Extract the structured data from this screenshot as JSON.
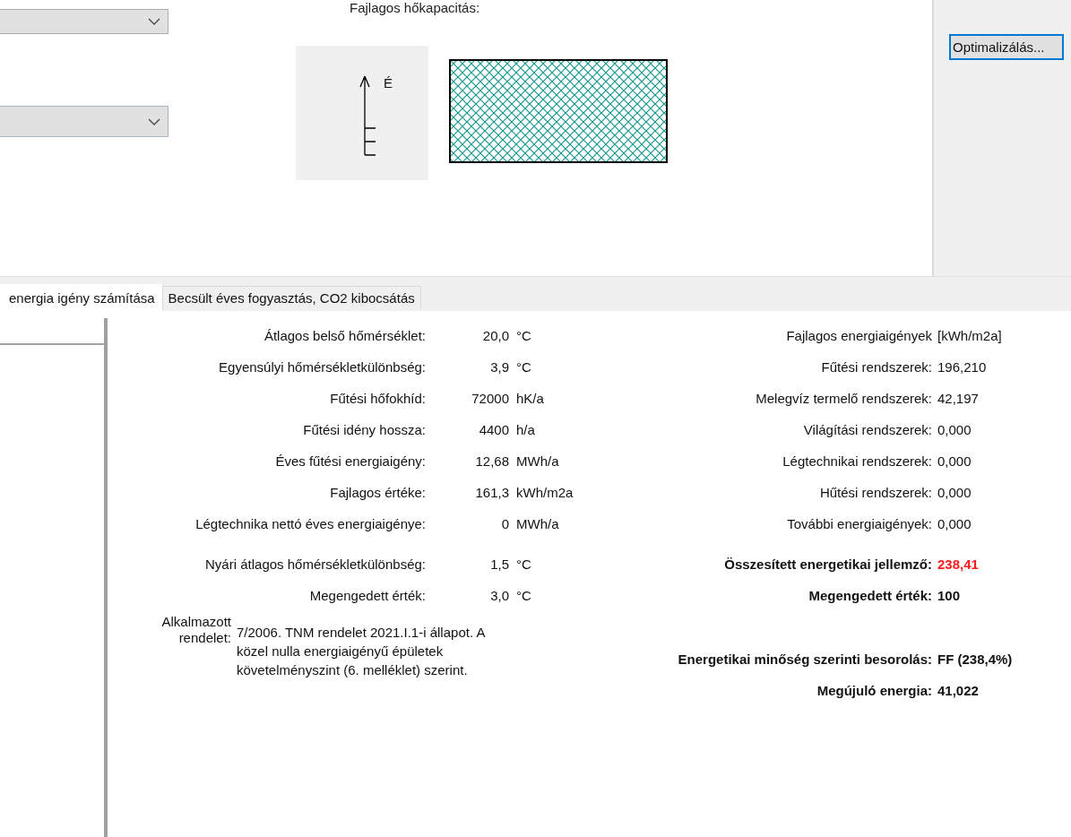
{
  "top": {
    "heading_label": "Fajlagos hőkapacitás:",
    "dropdowns": [
      {
        "focused": false
      },
      {
        "focused": true
      }
    ],
    "compass_label": "É",
    "button": "Optimalizálás..."
  },
  "tabs": [
    {
      "label": "energia igény számítása",
      "selected": true
    },
    {
      "label": "Becsült éves fogyasztás, CO2 kibocsátás",
      "selected": false
    }
  ],
  "left_rows": [
    {
      "label": "Átlagos belső hőmérséklet:",
      "value": "20,0",
      "unit": "°C"
    },
    {
      "label": "Egyensúlyi hőmérsékletkülönbség:",
      "value": "3,9",
      "unit": "°C"
    },
    {
      "label": "Fűtési hőfokhíd:",
      "value": "72000",
      "unit": "hK/a"
    },
    {
      "label": "Fűtési idény hossza:",
      "value": "4400",
      "unit": "h/a"
    },
    {
      "label": "Éves fűtési energiaigény:",
      "value": "12,68",
      "unit": "MWh/a"
    },
    {
      "label": "Fajlagos értéke:",
      "value": "161,3",
      "unit": "kWh/m2a"
    },
    {
      "label": "Légtechnika nettó éves energiaigénye:",
      "value": "0",
      "unit": "MWh/a"
    },
    {
      "label": "Nyári átlagos hőmérsékletkülönbség:",
      "value": "1,5",
      "unit": "°C"
    },
    {
      "label": "Megengedett érték:",
      "value": "3,0",
      "unit": "°C"
    }
  ],
  "regulation": {
    "label": "Alkalmazott rendelet:",
    "text": "7/2006. TNM rendelet 2021.I.1-i állapot. A közel nulla energiaigényű épületek követelményszint (6. melléklet) szerint."
  },
  "right_rows": [
    {
      "label": "Fajlagos energiaigények",
      "value": "[kWh/m2a]",
      "bold": false,
      "alert": false
    },
    {
      "label": "Fűtési rendszerek:",
      "value": "196,210",
      "bold": false,
      "alert": false
    },
    {
      "label": "Melegvíz termelő rendszerek:",
      "value": "42,197",
      "bold": false,
      "alert": false
    },
    {
      "label": "Világítási rendszerek:",
      "value": "0,000",
      "bold": false,
      "alert": false
    },
    {
      "label": "Légtechnikai rendszerek:",
      "value": "0,000",
      "bold": false,
      "alert": false
    },
    {
      "label": "Hűtési rendszerek:",
      "value": "0,000",
      "bold": false,
      "alert": false
    },
    {
      "label": "További energiaigények:",
      "value": "0,000",
      "bold": false,
      "alert": false
    },
    {
      "label": "Összesített energetikai jellemző:",
      "value": "238,41",
      "bold": true,
      "alert": true
    },
    {
      "label": "Megengedett érték:",
      "value": "100",
      "bold": true,
      "alert": false
    },
    {
      "label": "Energetikai minőség szerinti besorolás:",
      "value": "FF (238,4%)",
      "bold": true,
      "alert": false
    },
    {
      "label": "Megújuló energia:",
      "value": "41,022",
      "bold": true,
      "alert": false
    }
  ]
}
